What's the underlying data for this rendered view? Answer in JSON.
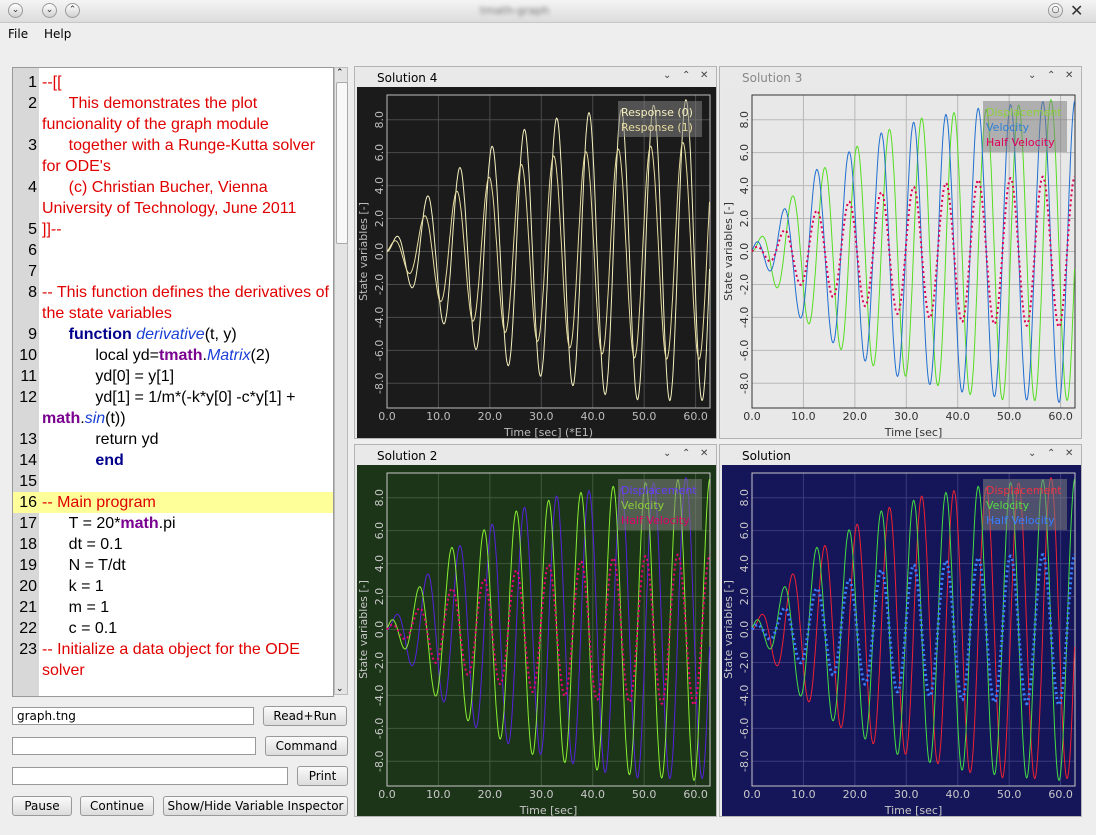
{
  "window": {
    "title": "tmath-graph"
  },
  "menu": {
    "file": "File",
    "help": "Help"
  },
  "editor": {
    "lines": [
      {
        "n": "1",
        "segs": [
          {
            "t": "--[[",
            "c": "c-red"
          }
        ]
      },
      {
        "n": "2",
        "segs": [
          {
            "t": "      This demonstrates the plot funcionality of the graph module",
            "c": "c-red"
          }
        ]
      },
      {
        "n": "3",
        "segs": [
          {
            "t": "      together with a Runge-Kutta solver for ODE's",
            "c": "c-red"
          }
        ]
      },
      {
        "n": "4",
        "segs": [
          {
            "t": "      (c) Christian Bucher, Vienna University of Technology, June 2011",
            "c": "c-red"
          }
        ]
      },
      {
        "n": "5",
        "segs": [
          {
            "t": "]]--",
            "c": "c-red"
          }
        ]
      },
      {
        "n": "6",
        "segs": [
          {
            "t": "",
            "c": ""
          }
        ]
      },
      {
        "n": "7",
        "segs": [
          {
            "t": "",
            "c": ""
          }
        ]
      },
      {
        "n": "8",
        "segs": [
          {
            "t": "-- This function defines the derivatives of the state variables",
            "c": "c-red"
          }
        ]
      },
      {
        "n": "9",
        "segs": [
          {
            "t": "      ",
            "c": ""
          },
          {
            "t": "function",
            "c": "kw"
          },
          {
            "t": " ",
            "c": ""
          },
          {
            "t": "derivative",
            "c": "fn"
          },
          {
            "t": "(t, y)",
            "c": ""
          }
        ]
      },
      {
        "n": "10",
        "segs": [
          {
            "t": "            local yd=",
            "c": ""
          },
          {
            "t": "tmath",
            "c": "mod"
          },
          {
            "t": ".",
            "c": ""
          },
          {
            "t": "Matrix",
            "c": "fn"
          },
          {
            "t": "(2)",
            "c": ""
          }
        ]
      },
      {
        "n": "11",
        "segs": [
          {
            "t": "            yd[0] = y[1]",
            "c": ""
          }
        ]
      },
      {
        "n": "12",
        "segs": [
          {
            "t": "            yd[1] = 1/m*(-k*y[0] -c*y[1] + ",
            "c": ""
          },
          {
            "t": "math",
            "c": "mod"
          },
          {
            "t": ".",
            "c": ""
          },
          {
            "t": "sin",
            "c": "fn"
          },
          {
            "t": "(t))",
            "c": ""
          }
        ]
      },
      {
        "n": "13",
        "segs": [
          {
            "t": "            return yd",
            "c": ""
          }
        ]
      },
      {
        "n": "14",
        "segs": [
          {
            "t": "            ",
            "c": ""
          },
          {
            "t": "end",
            "c": "kw"
          }
        ]
      },
      {
        "n": "15",
        "segs": [
          {
            "t": "",
            "c": ""
          }
        ]
      },
      {
        "n": "16",
        "segs": [
          {
            "t": "-- Main program",
            "c": "c-red"
          }
        ],
        "highlight": true
      },
      {
        "n": "17",
        "segs": [
          {
            "t": "      T = 20*",
            "c": ""
          },
          {
            "t": "math",
            "c": "mod"
          },
          {
            "t": ".pi",
            "c": ""
          }
        ]
      },
      {
        "n": "18",
        "segs": [
          {
            "t": "      dt = 0.1",
            "c": ""
          }
        ]
      },
      {
        "n": "19",
        "segs": [
          {
            "t": "      N = T/dt",
            "c": ""
          }
        ]
      },
      {
        "n": "20",
        "segs": [
          {
            "t": "      k = 1",
            "c": ""
          }
        ]
      },
      {
        "n": "21",
        "segs": [
          {
            "t": "      m = 1",
            "c": ""
          }
        ]
      },
      {
        "n": "22",
        "segs": [
          {
            "t": "      c = 0.1",
            "c": ""
          }
        ]
      },
      {
        "n": "23",
        "segs": [
          {
            "t": "-- Initialize a data object for the ODE solver",
            "c": "c-red"
          }
        ]
      }
    ]
  },
  "controls": {
    "file_value": "graph.tng",
    "read_run": "Read+Run",
    "command_value": "",
    "command": "Command",
    "print_value": "",
    "print": "Print",
    "pause": "Pause",
    "continue": "Continue",
    "toggle_inspector": "Show/Hide Variable Inspector"
  },
  "panels": [
    {
      "title": "Solution 4",
      "bg": "#1b1b1b",
      "fg": "#bdbdbd",
      "grid": "#4a4a4a",
      "ylabel": "State variables [-]",
      "xlabel": "Time [sec] (*E1)",
      "legend": [
        "Response (0)",
        "Response (1)"
      ],
      "series": [
        {
          "name": "Response (0)",
          "color": "#f5f0bf",
          "fn": "disp",
          "amp": 1.0,
          "dotted": false,
          "width": 1
        },
        {
          "name": "Response (1)",
          "color": "#e8dca0",
          "fn": "vel",
          "amp": 1.0,
          "dotted": false,
          "width": 1
        }
      ]
    },
    {
      "title": "Solution 3",
      "bg": "#e8e8e8",
      "fg": "#333333",
      "grid": "#b8b8b8",
      "ylabel": "State variables [-]",
      "xlabel": "Time [sec]",
      "legend": [
        "Displacement",
        "Velocity",
        "Half Velocity"
      ],
      "legend_colors": [
        "#8cd13a",
        "#2d7fd6",
        "#e0005a"
      ],
      "series": [
        {
          "name": "Displacement",
          "color": "#55dd22",
          "fn": "disp",
          "amp": 1.0,
          "dotted": false,
          "width": 1
        },
        {
          "name": "Velocity",
          "color": "#1f6fd0",
          "fn": "vel",
          "amp": 1.0,
          "dotted": false,
          "width": 1
        },
        {
          "name": "Half Velocity",
          "color": "#dd0055",
          "fn": "vel",
          "amp": 0.5,
          "dotted": true,
          "width": 2
        }
      ]
    },
    {
      "title": "Solution 2",
      "bg": "#1c3518",
      "fg": "#c8c8c8",
      "grid": "#3f5a3a",
      "ylabel": "State variables [-]",
      "xlabel": "Time [sec]",
      "legend": [
        "Displacement",
        "Velocity",
        "Half Velocity"
      ],
      "legend_colors": [
        "#6a3cff",
        "#8cd13a",
        "#e0006a"
      ],
      "series": [
        {
          "name": "Displacement",
          "color": "#5522dd",
          "fn": "disp",
          "amp": 1.0,
          "dotted": false,
          "width": 1
        },
        {
          "name": "Velocity",
          "color": "#88ee33",
          "fn": "vel",
          "amp": 1.0,
          "dotted": false,
          "width": 1
        },
        {
          "name": "Half Velocity",
          "color": "#ee0077",
          "fn": "vel",
          "amp": 0.5,
          "dotted": true,
          "width": 2
        }
      ]
    },
    {
      "title": "Solution",
      "bg": "#15155a",
      "fg": "#c8c8c8",
      "grid": "#3a3a7a",
      "ylabel": "State variables [-]",
      "xlabel": "Time [sec]",
      "legend": [
        "Displacement",
        "Velocity",
        "Half Velocity"
      ],
      "legend_colors": [
        "#ee3344",
        "#55dd44",
        "#3a7fff"
      ],
      "series": [
        {
          "name": "Displacement",
          "color": "#ee2233",
          "fn": "disp",
          "amp": 1.0,
          "dotted": false,
          "width": 1
        },
        {
          "name": "Velocity",
          "color": "#44dd44",
          "fn": "vel",
          "amp": 1.0,
          "dotted": false,
          "width": 1
        },
        {
          "name": "Half Velocity",
          "color": "#3a7fff",
          "fn": "vel",
          "amp": 0.5,
          "dotted": true,
          "width": 3
        }
      ]
    }
  ],
  "chart_data": {
    "type": "line",
    "xlabel": "Time [sec]",
    "ylabel": "State variables [-]",
    "xlim": [
      0,
      62.8
    ],
    "ylim": [
      -9.5,
      9.5
    ],
    "xticks": [
      "0.0",
      "10.0",
      "20.0",
      "30.0",
      "40.0",
      "50.0",
      "60.0"
    ],
    "yticks": [
      "8.0",
      "6.0",
      "4.0",
      "2.0",
      "0.0",
      "-2.0",
      "-4.0",
      "-6.0",
      "-8.0"
    ],
    "series": [
      {
        "name": "Displacement",
        "x": [
          0,
          10,
          20,
          30,
          40,
          50,
          60
        ],
        "envelope": [
          0.0,
          3.7,
          6.0,
          7.4,
          8.3,
          8.8,
          9.2
        ]
      },
      {
        "name": "Velocity",
        "x": [
          0,
          10,
          20,
          30,
          40,
          50,
          60
        ],
        "envelope": [
          0.0,
          3.7,
          6.0,
          7.4,
          8.3,
          8.8,
          9.2
        ]
      },
      {
        "name": "Half Velocity",
        "x": [
          0,
          10,
          20,
          30,
          40,
          50,
          60
        ],
        "envelope": [
          0.0,
          1.9,
          3.0,
          3.7,
          4.2,
          4.4,
          4.6
        ]
      }
    ]
  }
}
